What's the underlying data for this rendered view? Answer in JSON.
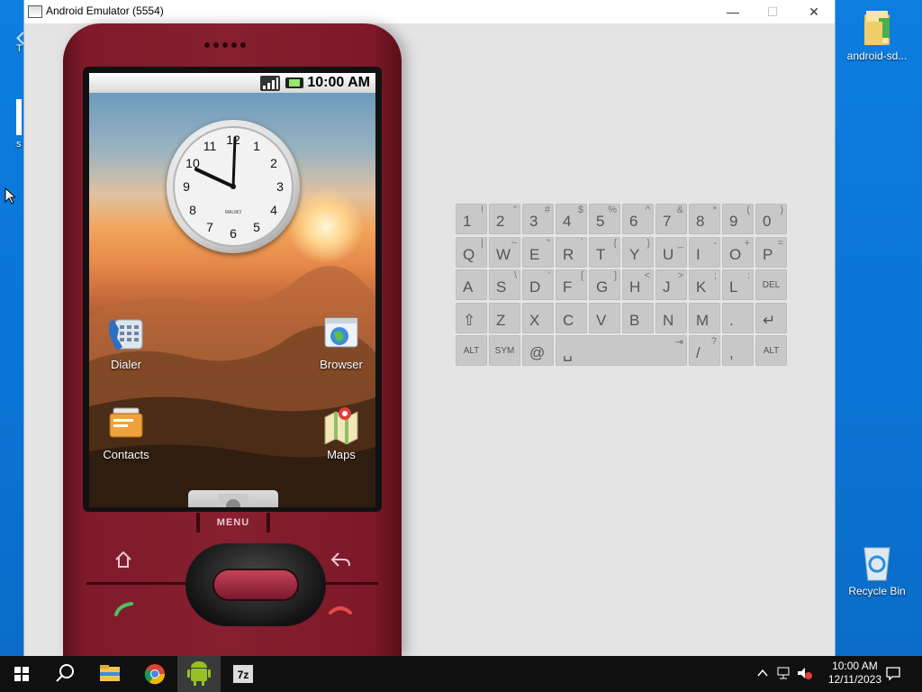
{
  "desktop": {
    "icons": [
      {
        "label": "android-sd...",
        "name": "android-sdk-folder-icon"
      },
      {
        "label": "Recycle Bin",
        "name": "recycle-bin-icon"
      }
    ],
    "left_stubs": [
      "T",
      "s"
    ]
  },
  "window": {
    "title": "Android Emulator (5554)",
    "controls": {
      "minimize": "—",
      "maximize": "☐",
      "close": "✕"
    }
  },
  "phone": {
    "status_time": "10:00 AM",
    "clock_brand": "MALMO",
    "clock_numbers": [
      "12",
      "1",
      "2",
      "3",
      "4",
      "5",
      "6",
      "7",
      "8",
      "9",
      "10",
      "11"
    ],
    "apps": [
      {
        "label": "Dialer"
      },
      {
        "label": "Browser"
      },
      {
        "label": "Contacts"
      },
      {
        "label": "Maps"
      }
    ],
    "menu_label": "MENU"
  },
  "keyboard": {
    "rows": [
      [
        {
          "m": "1",
          "s": "!"
        },
        {
          "m": "2",
          "s": "\""
        },
        {
          "m": "3",
          "s": "#"
        },
        {
          "m": "4",
          "s": "$"
        },
        {
          "m": "5",
          "s": "%"
        },
        {
          "m": "6",
          "s": "^"
        },
        {
          "m": "7",
          "s": "&"
        },
        {
          "m": "8",
          "s": "*"
        },
        {
          "m": "9",
          "s": "("
        },
        {
          "m": "0",
          "s": ")"
        }
      ],
      [
        {
          "m": "Q",
          "s": "|"
        },
        {
          "m": "W",
          "s": "~"
        },
        {
          "m": "E",
          "s": "\""
        },
        {
          "m": "R",
          "s": "`"
        },
        {
          "m": "T",
          "s": "{"
        },
        {
          "m": "Y",
          "s": "}"
        },
        {
          "m": "U",
          "s": "_"
        },
        {
          "m": "I",
          "s": "-"
        },
        {
          "m": "O",
          "s": "+"
        },
        {
          "m": "P",
          "s": "="
        }
      ],
      [
        {
          "m": "A",
          "s": ""
        },
        {
          "m": "S",
          "s": "\\"
        },
        {
          "m": "D",
          "s": "'"
        },
        {
          "m": "F",
          "s": "["
        },
        {
          "m": "G",
          "s": "]"
        },
        {
          "m": "H",
          "s": "<"
        },
        {
          "m": "J",
          "s": ">"
        },
        {
          "m": "K",
          "s": ";"
        },
        {
          "m": "L",
          "s": ":"
        },
        {
          "m": "DEL",
          "s": ""
        }
      ],
      [
        {
          "m": "⇧",
          "s": ""
        },
        {
          "m": "Z",
          "s": ""
        },
        {
          "m": "X",
          "s": ""
        },
        {
          "m": "C",
          "s": ""
        },
        {
          "m": "V",
          "s": ""
        },
        {
          "m": "B",
          "s": ""
        },
        {
          "m": "N",
          "s": ""
        },
        {
          "m": "M",
          "s": ""
        },
        {
          "m": ".",
          "s": ""
        },
        {
          "m": "↵",
          "s": ""
        }
      ]
    ],
    "bottom_row": {
      "alt_left": "ALT",
      "sym": "SYM",
      "at": "@",
      "space": "␣",
      "tab": "⇥",
      "slash": "/",
      "slash_shift": "?",
      "comma": ",",
      "alt_right": "ALT"
    }
  },
  "taskbar": {
    "time": "10:00 AM",
    "date": "12/11/2023"
  },
  "colors": {
    "phone_body": "#86202f",
    "accent": "#0a78d7"
  }
}
